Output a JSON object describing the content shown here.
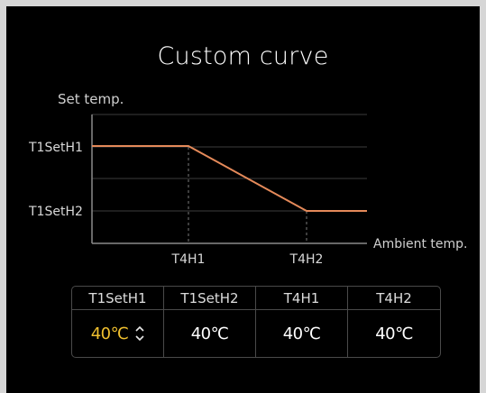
{
  "screen": {
    "title": "Custom curve"
  },
  "chart_data": {
    "type": "line",
    "ylabel": "Set temp.",
    "xlabel": "Ambient temp.",
    "y_ticks": [
      "T1SetH1",
      "T1SetH2"
    ],
    "x_ticks": [
      "T4H1",
      "T4H2"
    ],
    "curve_color": "#e58a5a",
    "grid": true
  },
  "table": {
    "headers": [
      "T1SetH1",
      "T1SetH2",
      "T4H1",
      "T4H2"
    ],
    "values": [
      "40℃",
      "40℃",
      "40℃",
      "40℃"
    ],
    "selected_index": 0,
    "selected_color": "#f0c02f"
  },
  "icons": {
    "stepper": "up-down-chevron-icon"
  }
}
